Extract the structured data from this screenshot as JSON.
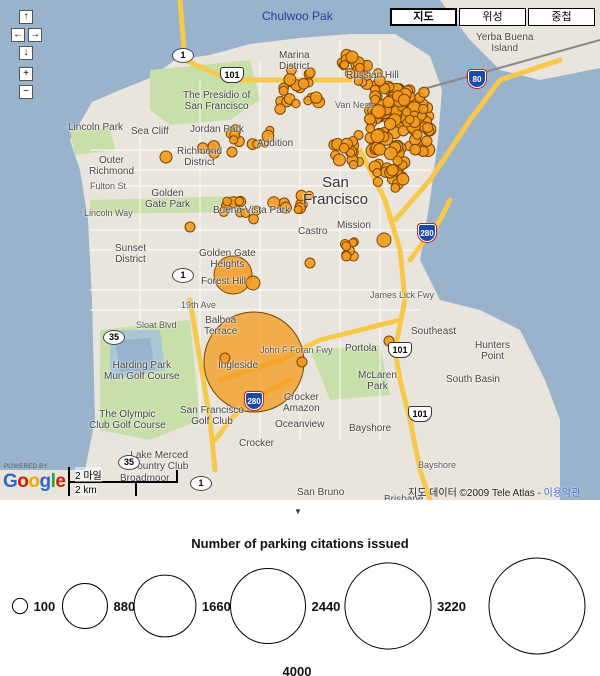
{
  "map": {
    "user_name": "Chulwoo Pak",
    "map_types": [
      "지도",
      "위성",
      "중첩"
    ],
    "active_map_type": "지도",
    "nav_buttons": {
      "up": "↑",
      "left": "←",
      "right": "→",
      "down": "↓",
      "zoom_in": "+",
      "zoom_out": "−"
    },
    "logo": {
      "powered_by": "POWERED BY",
      "text": "Google"
    },
    "scale": {
      "imperial": "2 마일",
      "metric": "2 km"
    },
    "copyright": "지도 데이터 ©2009 Tele Atlas - ",
    "terms_link": "이용약관",
    "place_labels": [
      "Marina District",
      "Russian Hill",
      "Yerba Buena Island",
      "The Presidio of San Francisco",
      "Lincoln Park",
      "Sea Cliff",
      "Jordan Park",
      "Richmond District",
      "Outer Richmond",
      "Golden Gate Park",
      "Buena Vista Park",
      "Sunset District",
      "Golden Gate Heights",
      "Forest Hill",
      "Castro",
      "Mission",
      "San Francisco",
      "Balboa Terrace",
      "Ingleside",
      "Harding Park Mun Golf Course",
      "The Olympic Club Golf Course",
      "San Francisco Golf Club",
      "Lake Merced Country Club",
      "Broadmoor",
      "Oceanview",
      "Crocker",
      "Crocker Amazon",
      "McLaren Park",
      "Portola",
      "Bayshore",
      "Southeast",
      "Hunters Point",
      "South Basin",
      "San Bruno",
      "Brisbane",
      "Addition"
    ],
    "street_labels": [
      "Fulton St",
      "Lincoln Way",
      "Sloat Blvd",
      "19th Ave",
      "Van Ness",
      "James Lick Fwy",
      "John F Foran Fwy",
      "Bayshore"
    ],
    "route_shields": [
      "1",
      "101",
      "80",
      "35",
      "280"
    ],
    "marker_color": "#f39a1c",
    "marker_stroke": "#7a4200"
  },
  "legend": {
    "title": "Number of parking citations issued",
    "items": [
      {
        "value": 100,
        "label": "100"
      },
      {
        "value": 880,
        "label": "880"
      },
      {
        "value": 1660,
        "label": "1660"
      },
      {
        "value": 2440,
        "label": "2440"
      },
      {
        "value": 3220,
        "label": "3220"
      },
      {
        "value": 4000,
        "label": "4000"
      }
    ]
  },
  "toggle_arrow": "▼"
}
